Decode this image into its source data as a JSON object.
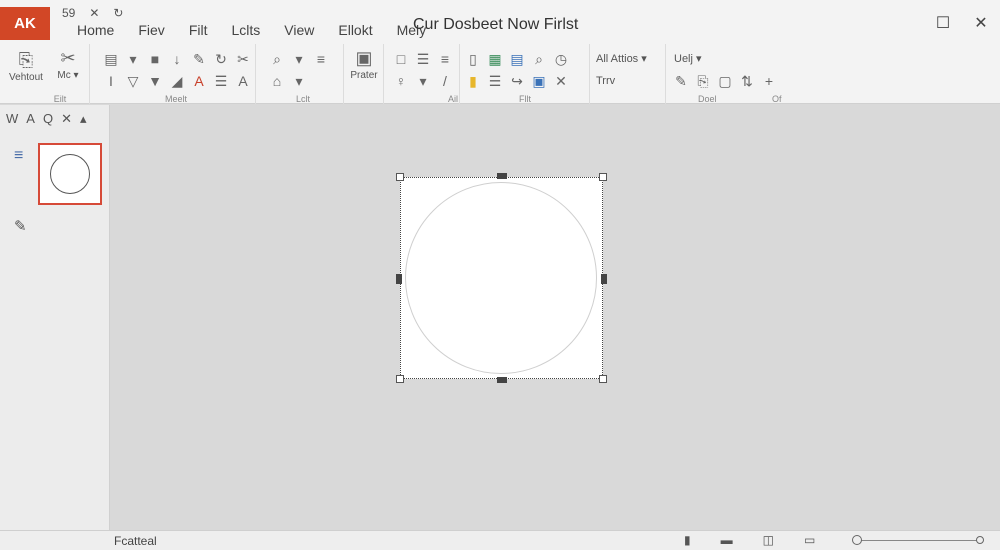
{
  "app": {
    "logo": "AK",
    "title": "Cur Dosbeet Now Firlst"
  },
  "quick_access": [
    "59",
    "✕",
    "↻"
  ],
  "menu": [
    "Home",
    "Fiev",
    "Filt",
    "Lclts",
    "View",
    "Ellokt",
    "Mely"
  ],
  "window_controls": {
    "maximize": "☐",
    "close": "✕"
  },
  "ribbon": {
    "groups": [
      {
        "label": "Eilt",
        "buttons": [
          "Vehtout",
          "Mc ▾"
        ]
      },
      {
        "label": "Meelt"
      },
      {
        "label": "Lclt"
      },
      {
        "label": "",
        "buttons": [
          "Prater"
        ]
      },
      {
        "label": "Ail"
      },
      {
        "label": "Fllt"
      },
      {
        "label": "",
        "texts": [
          "All Attios ▾",
          "Trrv"
        ]
      },
      {
        "label": "Doel",
        "texts": [
          "Uelj ▾"
        ]
      },
      {
        "label": "Of"
      }
    ]
  },
  "left_panel": {
    "tools": [
      "W",
      "A",
      "Q",
      "✕",
      "▴"
    ]
  },
  "status": {
    "text": "Fcatteal"
  },
  "colors": {
    "accent": "#d24726",
    "selection": "#d64a38"
  }
}
